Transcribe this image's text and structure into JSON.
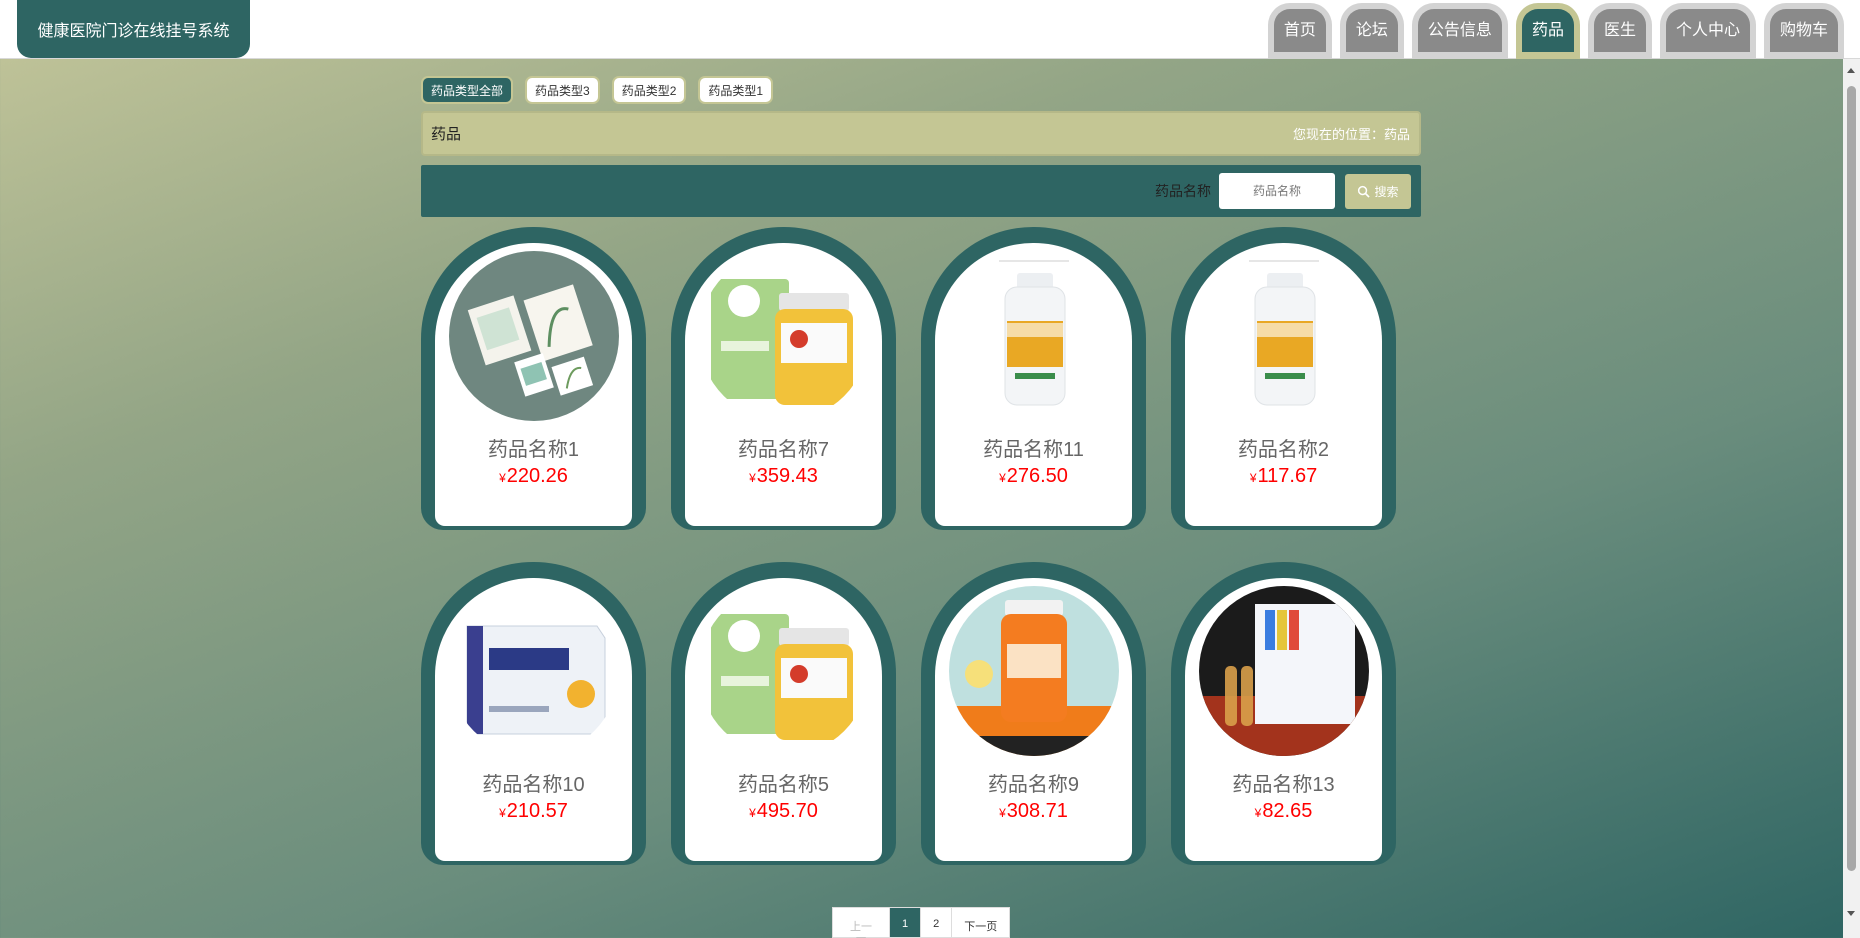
{
  "header": {
    "logo": "健康医院门诊在线挂号系统",
    "nav": [
      {
        "label": "首页",
        "active": false
      },
      {
        "label": "论坛",
        "active": false
      },
      {
        "label": "公告信息",
        "active": false
      },
      {
        "label": "药品",
        "active": true
      },
      {
        "label": "医生",
        "active": false
      },
      {
        "label": "个人中心",
        "active": false
      },
      {
        "label": "购物车",
        "active": false
      }
    ]
  },
  "type_tabs": [
    "药品类型全部",
    "药品类型3",
    "药品类型2",
    "药品类型1"
  ],
  "breadcrumb": {
    "title": "药品",
    "location": "您现在的位置：药品"
  },
  "search": {
    "label": "药品名称",
    "placeholder": "药品名称",
    "button": "搜索"
  },
  "products": [
    {
      "name": "药品名称1",
      "price": "220.26",
      "currency": "¥",
      "image": "herbal-packages"
    },
    {
      "name": "药品名称7",
      "price": "359.43",
      "currency": "¥",
      "image": "supplement-jar-green-box"
    },
    {
      "name": "药品名称11",
      "price": "276.50",
      "currency": "¥",
      "image": "white-capsule-bottle"
    },
    {
      "name": "药品名称2",
      "price": "117.67",
      "currency": "¥",
      "image": "white-capsule-bottle"
    },
    {
      "name": "药品名称10",
      "price": "210.57",
      "currency": "¥",
      "image": "medicine-box"
    },
    {
      "name": "药品名称5",
      "price": "495.70",
      "currency": "¥",
      "image": "supplement-jar-green-box"
    },
    {
      "name": "药品名称9",
      "price": "308.71",
      "currency": "¥",
      "image": "orange-vitamin-bottle"
    },
    {
      "name": "药品名称13",
      "price": "82.65",
      "currency": "¥",
      "image": "ampoules-box"
    }
  ],
  "pagination": {
    "prev": "上一页",
    "pages": [
      "1",
      "2"
    ],
    "current": "1",
    "next": "下一页"
  },
  "colors": {
    "primary": "#2e6563",
    "accent": "#c4c694",
    "price": "#ff0000"
  }
}
